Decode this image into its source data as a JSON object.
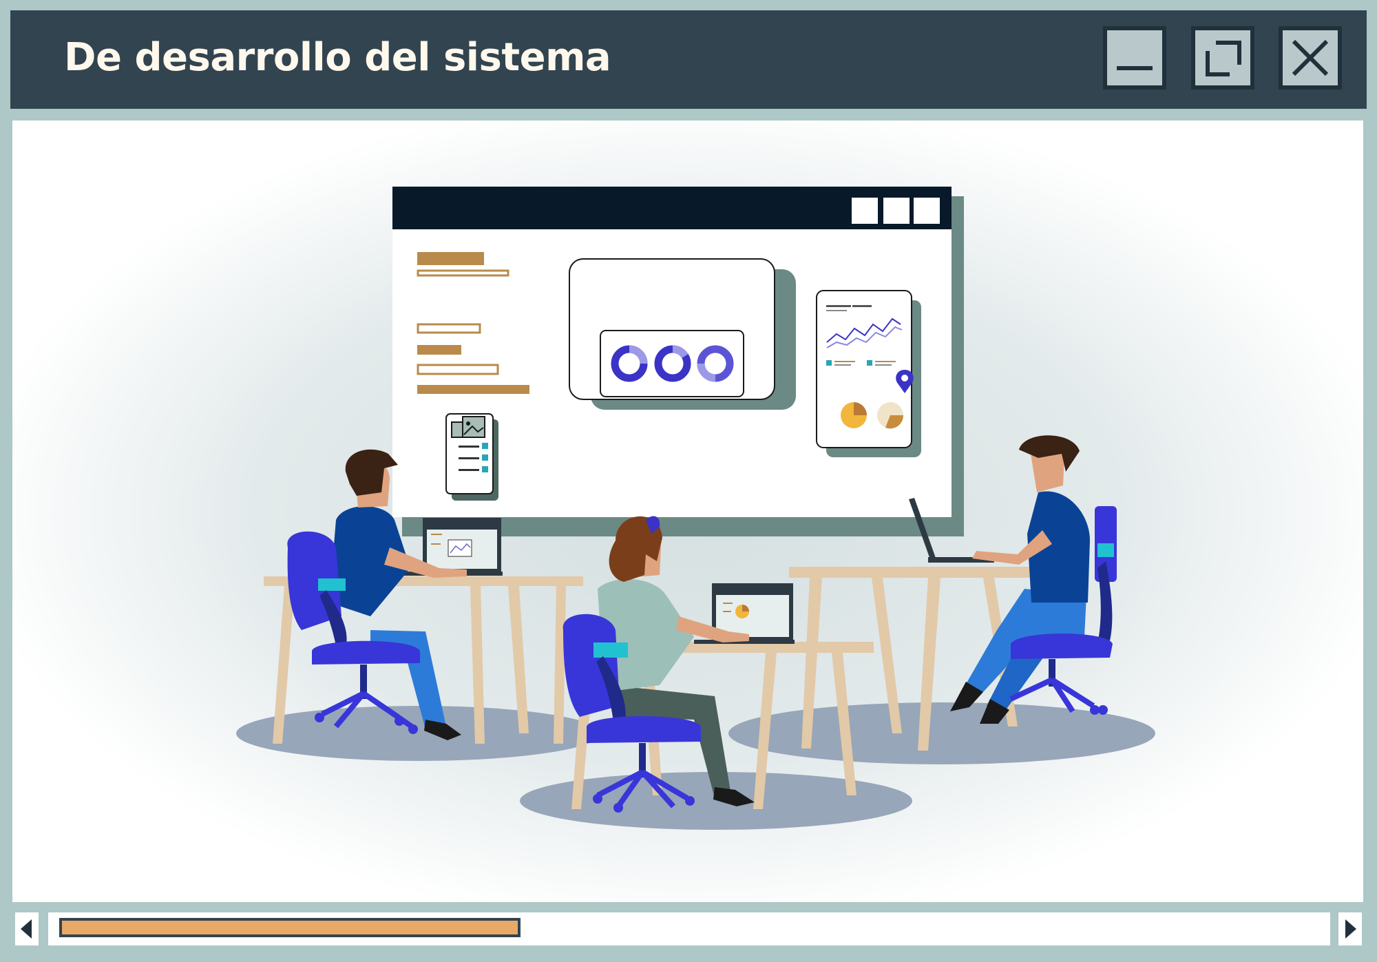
{
  "window": {
    "title": "De desarrollo del sistema",
    "controls": [
      "minimize",
      "restore",
      "close"
    ]
  },
  "scrollbar": {
    "thumb_fraction": 0.362
  },
  "colors": {
    "titlebar": "#324450",
    "frame": "#adc8c6",
    "accent_blue": "#3a33d6",
    "accent_gold": "#b98a4a",
    "thumb": "#e8a868"
  }
}
